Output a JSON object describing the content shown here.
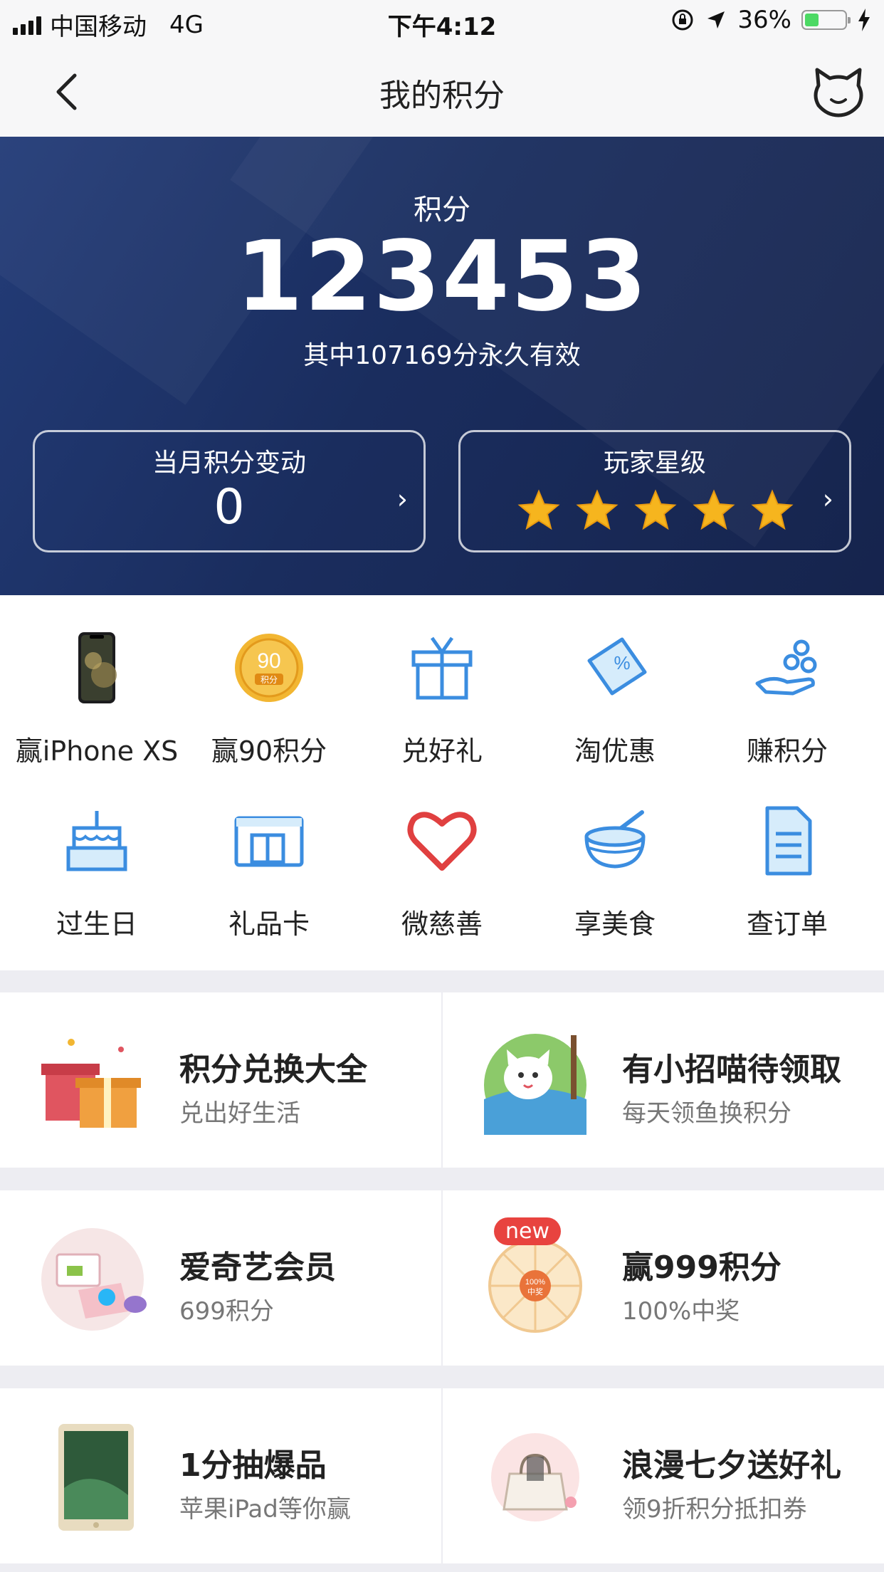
{
  "status_bar": {
    "carrier": "中国移动",
    "network": "4G",
    "time": "下午4:12",
    "battery": "36%",
    "battery_level": 0.36
  },
  "nav": {
    "title": "我的积分"
  },
  "hero": {
    "label": "积分",
    "value": "123453",
    "sub": "其中107169分永久有效",
    "monthly": {
      "title": "当月积分变动",
      "value": "0"
    },
    "level": {
      "title": "玩家星级",
      "stars": 5
    },
    "colors": {
      "bg_start": "#233c78",
      "bg_end": "#16244d"
    }
  },
  "grid": {
    "items": [
      {
        "label": "赢iPhone XS",
        "icon": "iphone-icon"
      },
      {
        "label": "赢90积分",
        "icon": "points-coin-icon"
      },
      {
        "label": "兑好礼",
        "icon": "gift-icon"
      },
      {
        "label": "淘优惠",
        "icon": "coupon-icon"
      },
      {
        "label": "赚积分",
        "icon": "earn-points-icon"
      },
      {
        "label": "过生日",
        "icon": "birthday-cake-icon"
      },
      {
        "label": "礼品卡",
        "icon": "gift-card-icon"
      },
      {
        "label": "微慈善",
        "icon": "heart-icon"
      },
      {
        "label": "享美食",
        "icon": "food-bowl-icon"
      },
      {
        "label": "查订单",
        "icon": "order-doc-icon"
      }
    ]
  },
  "promos": [
    {
      "title": "积分兑换大全",
      "sub": "兑出好生活",
      "icon": "gift-boxes-icon"
    },
    {
      "title": "有小招喵待领取",
      "sub": "每天领鱼换积分",
      "icon": "cat-fishing-icon"
    },
    {
      "title": "爱奇艺会员",
      "sub": "699积分",
      "icon": "iqiyi-icon"
    },
    {
      "title": "赢999积分",
      "sub": "100%中奖",
      "icon": "lottery-wheel-icon",
      "badge": "new"
    },
    {
      "title": "1分抽爆品",
      "sub": "苹果iPad等你赢",
      "icon": "ipad-icon"
    },
    {
      "title": "浪漫七夕送好礼",
      "sub": "领9折积分抵扣券",
      "icon": "handbag-icon"
    }
  ],
  "colors": {
    "accent_blue": "#3b8de0",
    "star_gold": "#f6b51e",
    "badge_red": "#e8433f"
  }
}
